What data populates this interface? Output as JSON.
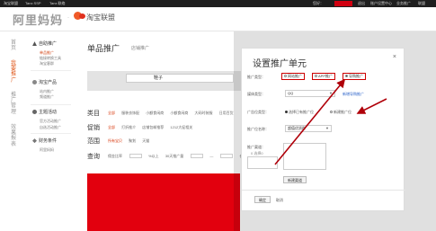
{
  "topbar": {
    "links": [
      "淘宝联盟",
      "Tanx SSP",
      "Tanx 联络"
    ],
    "right_items": [
      "您好：",
      "退出",
      "账户设置中心",
      "业务推广",
      "联盟"
    ]
  },
  "header": {
    "logo": "阿里妈妈",
    "logo_dot": "·",
    "sub_brand": "淘宝联盟"
  },
  "vnav": [
    {
      "label": "首页",
      "active": false
    },
    {
      "label": "我要推广",
      "active": true
    },
    {
      "label": "推广管理",
      "active": false
    },
    {
      "label": "效果报表",
      "active": false
    }
  ],
  "sidebar": {
    "sections": [
      {
        "title": "自助推广",
        "items": [
          "单品推广",
          "链接转换工具",
          "淘宝客群"
        ]
      },
      {
        "title": "淘宝产品",
        "items": [
          "站内推广",
          "频道推广"
        ]
      },
      {
        "title": "主题活动",
        "items": [
          "官方活动推广",
          "自选活动推广"
        ]
      },
      {
        "title": "财务条件",
        "items": [
          "阿里妈妈"
        ]
      }
    ]
  },
  "main": {
    "title": "单品推广",
    "subtitle": "店铺推广",
    "search_value": "鞋子",
    "filters": [
      {
        "label": "类目",
        "options": [
          "全部",
          "服装衣饰配",
          "小额食闲商",
          "小额食闲商",
          "大码时装服",
          "日用百货"
        ],
        "active": 0
      },
      {
        "label": "促销",
        "options": [
          "全部",
          "打折推介",
          "店铺包邮推荐",
          "1212大促相关"
        ],
        "active": 0
      },
      {
        "label": "范围",
        "options": [
          "所有宝贝",
          "聚划",
          "天猫"
        ],
        "active": 0
      },
      {
        "label": "查询",
        "options": [
          "佣金比率",
          "%以上",
          "30天推广量",
          "—",
          "价格"
        ],
        "active": -1
      }
    ]
  },
  "modal": {
    "title": "设置推广单元",
    "close": "×",
    "fields": {
      "promo_type_label": "推广类型：",
      "promo_types": [
        {
          "label": "网站推广",
          "selected": false
        },
        {
          "label": "APP推广",
          "selected": false
        },
        {
          "label": "导购推广",
          "selected": true
        }
      ],
      "media_label": "媒体类型：",
      "media_value": "QQ",
      "new_media_link": "新增导购推广",
      "ad_label": "广告位类型：",
      "ad_options": [
        "选择已有推广位",
        "新建推广位"
      ],
      "group_label": "推广位名称：",
      "group_value": "超值优质群",
      "channel_label": "推广渠道：",
      "channel_hint": "0 选择0",
      "new_channel_button": "新建渠道"
    },
    "ok": "确定",
    "cancel": "取消"
  },
  "accent_colors": {
    "highlight_box": "#cc0000",
    "arrow": "#b0000a",
    "red_banner": "#e2000e",
    "brand_orange": "#f05a28"
  }
}
